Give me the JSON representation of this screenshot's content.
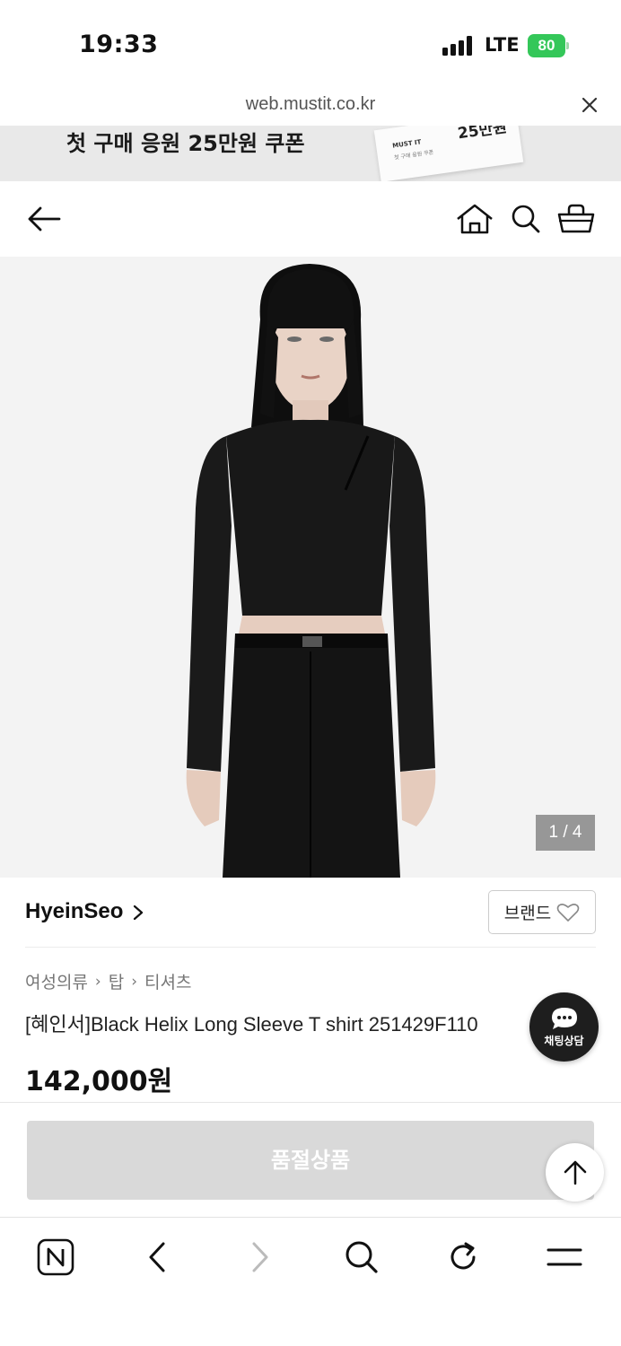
{
  "status_bar": {
    "time": "19:33",
    "network": "LTE",
    "battery": "80"
  },
  "url_bar": {
    "url": "web.mustit.co.kr"
  },
  "banner": {
    "text": "첫 구매 응원 25만원 쿠폰",
    "coupon_brand": "MUST IT",
    "coupon_sub": "첫 구매 응원 쿠폰",
    "coupon_value": "25만원"
  },
  "product": {
    "image_pager": "1 / 4",
    "brand": "HyeinSeo",
    "brand_button": "브랜드",
    "breadcrumb": [
      "여성의류",
      "탑",
      "티셔츠"
    ],
    "title": "[혜인서]Black Helix Long Sleeve T shirt 251429F110",
    "price": "142,000원"
  },
  "chat": {
    "label": "채팅상담"
  },
  "cta": {
    "label": "품절상품"
  },
  "icons": {
    "nav": [
      "back-arrow-icon",
      "home-icon",
      "search-icon",
      "cart-icon"
    ],
    "toolbar": [
      "naver-n-icon",
      "chevron-left-icon",
      "chevron-right-icon",
      "search-icon",
      "refresh-icon",
      "menu-icon"
    ]
  },
  "colors": {
    "battery": "#34c759",
    "cta_disabled": "#d9d9d9",
    "chat_bg": "#1e1e1e"
  }
}
